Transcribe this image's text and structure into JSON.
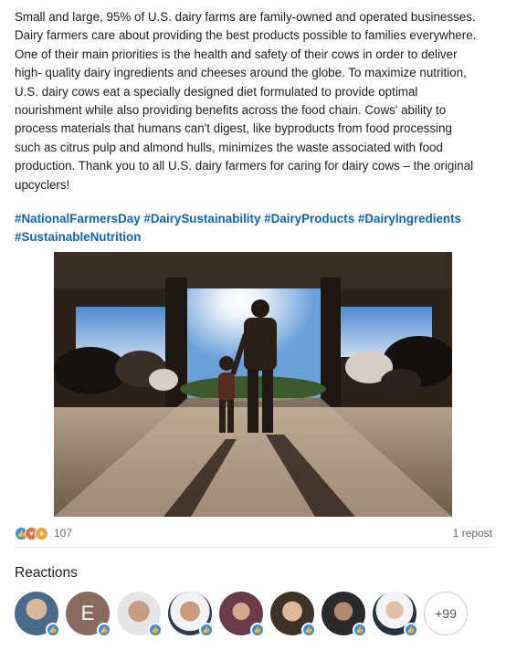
{
  "post": {
    "lines": [
      "Small and large, 95% of U.S. dairy farms are family-owned and operated businesses.",
      "Dairy farmers care about providing the best products possible to families everywhere.",
      "One of their main priorities is the health and safety of their cows in order to deliver",
      "high- quality dairy ingredients and cheeses around the globe. To maximize nutrition,",
      "U.S. dairy cows eat a specially designed diet formulated to provide optimal",
      "nourishment while also providing benefits across the food chain. Cows' ability to",
      "process materials that humans can't digest, like byproducts from food processing",
      "such as citrus pulp and almond hulls, minimizes the waste associated with food",
      "production. Thank you to all U.S. dairy farmers for caring for dairy cows – the original",
      "upcyclers!"
    ],
    "hashtags": [
      "#NationalFarmersDay",
      "#DairySustainability",
      "#DairyProducts",
      "#DairyIngredients",
      "#SustainableNutrition"
    ]
  },
  "social": {
    "reaction_icons": [
      "like-icon",
      "love-icon",
      "celebrate-icon"
    ],
    "reaction_count": "107",
    "reposts": "1 repost"
  },
  "reactions": {
    "title": "Reactions",
    "avatars": [
      {
        "initial": ""
      },
      {
        "initial": "E"
      },
      {
        "initial": ""
      },
      {
        "initial": ""
      },
      {
        "initial": ""
      },
      {
        "initial": ""
      },
      {
        "initial": ""
      },
      {
        "initial": ""
      }
    ],
    "more_label": "+99"
  },
  "colors": {
    "hashtag": "#0a66c2",
    "like": "#378fe9",
    "love": "#df704d",
    "celebrate": "#e7a33e"
  }
}
